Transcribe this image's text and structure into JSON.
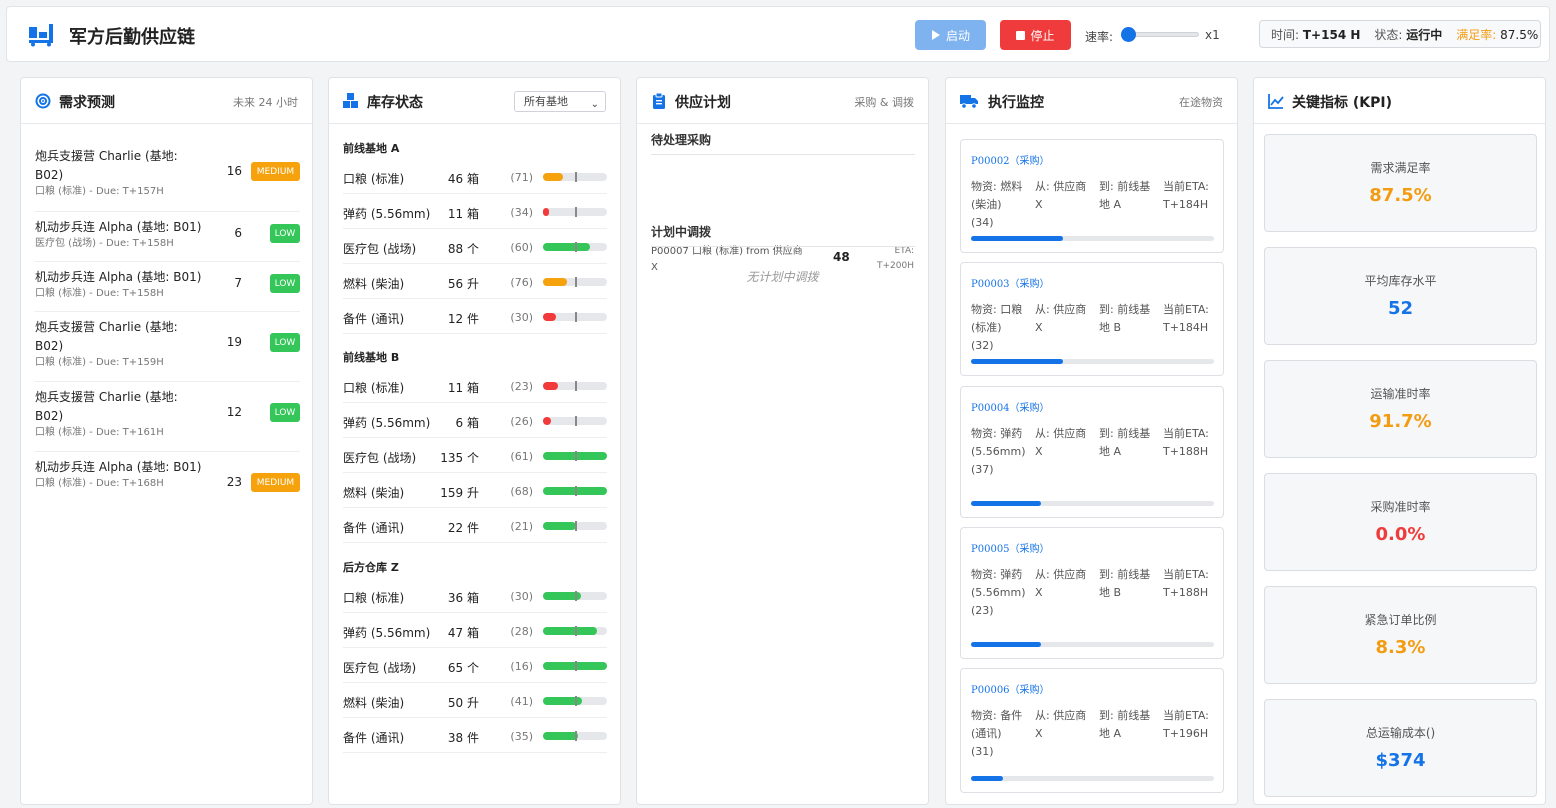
{
  "header": {
    "title": "军方后勤供应链",
    "start_label": "启动",
    "stop_label": "停止",
    "speed_label": "速率:",
    "speed_value": "x1",
    "speed_slider_value": 0,
    "time_label": "时间:",
    "time_value": "T+154 H",
    "state_label": "状态:",
    "state_value": "运行中",
    "rate_label": "满足率:",
    "rate_value": "87.5%"
  },
  "colors": {
    "accent_blue": "#1573e8",
    "start_button": "#7fb3ef",
    "stop_button": "#ef3b3b",
    "medium_badge": "#f5a20c",
    "low_badge": "#34c659",
    "bar_green": "#34c659",
    "bar_orange": "#f5a20c",
    "bar_red": "#f23a3a",
    "kpi_orange": "#f39c12",
    "kpi_blue": "#1573e8",
    "kpi_red": "#ef3b3b"
  },
  "demand": {
    "title": "需求预测",
    "subtitle": "未来 24 小时",
    "items": [
      {
        "name": "炮兵支援营 Charlie (基地: B02)",
        "meta": "口粮 (标准) - Due: T+157H",
        "qty": "16",
        "priority": "MEDIUM"
      },
      {
        "name": "机动步兵连 Alpha (基地: B01)",
        "meta": "医疗包 (战场) - Due: T+158H",
        "qty": "6",
        "priority": "LOW"
      },
      {
        "name": "机动步兵连 Alpha (基地: B01)",
        "meta": "口粮 (标准) - Due: T+158H",
        "qty": "7",
        "priority": "LOW"
      },
      {
        "name": "炮兵支援营 Charlie (基地: B02)",
        "meta": "口粮 (标准) - Due: T+159H",
        "qty": "19",
        "priority": "LOW"
      },
      {
        "name": "炮兵支援营 Charlie (基地: B02)",
        "meta": "口粮 (标准) - Due: T+161H",
        "qty": "12",
        "priority": "LOW"
      },
      {
        "name": "机动步兵连 Alpha (基地: B01)",
        "meta": "口粮 (标准) - Due: T+168H",
        "qty": "23",
        "priority": "MEDIUM"
      }
    ]
  },
  "inventory": {
    "title": "库存状态",
    "filter_value": "所有基地",
    "bases": [
      {
        "name": "前线基地 A",
        "items": [
          {
            "name": "口粮 (标准)",
            "qty": "46 箱",
            "threshold": "(71)",
            "level": 0.32,
            "mark": 0.5,
            "status": "orange"
          },
          {
            "name": "弹药 (5.56mm)",
            "qty": "11 箱",
            "threshold": "(34)",
            "level": 0.08,
            "mark": 0.5,
            "status": "red"
          },
          {
            "name": "医疗包 (战场)",
            "qty": "88 个",
            "threshold": "(60)",
            "level": 0.73,
            "mark": 0.5,
            "status": "green"
          },
          {
            "name": "燃料 (柴油)",
            "qty": "56 升",
            "threshold": "(76)",
            "level": 0.37,
            "mark": 0.5,
            "status": "orange"
          },
          {
            "name": "备件 (通讯)",
            "qty": "12 件",
            "threshold": "(30)",
            "level": 0.2,
            "mark": 0.5,
            "status": "red"
          }
        ]
      },
      {
        "name": "前线基地 B",
        "items": [
          {
            "name": "口粮 (标准)",
            "qty": "11 箱",
            "threshold": "(23)",
            "level": 0.24,
            "mark": 0.5,
            "status": "red"
          },
          {
            "name": "弹药 (5.56mm)",
            "qty": "6 箱",
            "threshold": "(26)",
            "level": 0.12,
            "mark": 0.5,
            "status": "red"
          },
          {
            "name": "医疗包 (战场)",
            "qty": "135 个",
            "threshold": "(61)",
            "level": 1.0,
            "mark": 0.5,
            "status": "green"
          },
          {
            "name": "燃料 (柴油)",
            "qty": "159 升",
            "threshold": "(68)",
            "level": 1.0,
            "mark": 0.5,
            "status": "green"
          },
          {
            "name": "备件 (通讯)",
            "qty": "22 件",
            "threshold": "(21)",
            "level": 0.52,
            "mark": 0.5,
            "status": "green"
          }
        ]
      },
      {
        "name": "后方仓库 Z",
        "items": [
          {
            "name": "口粮 (标准)",
            "qty": "36 箱",
            "threshold": "(30)",
            "level": 0.6,
            "mark": 0.5,
            "status": "green"
          },
          {
            "name": "弹药 (5.56mm)",
            "qty": "47 箱",
            "threshold": "(28)",
            "level": 0.84,
            "mark": 0.5,
            "status": "green"
          },
          {
            "name": "医疗包 (战场)",
            "qty": "65 个",
            "threshold": "(16)",
            "level": 1.0,
            "mark": 0.5,
            "status": "green"
          },
          {
            "name": "燃料 (柴油)",
            "qty": "50 升",
            "threshold": "(41)",
            "level": 0.61,
            "mark": 0.5,
            "status": "green"
          },
          {
            "name": "备件 (通讯)",
            "qty": "38 件",
            "threshold": "(35)",
            "level": 0.54,
            "mark": 0.5,
            "status": "green"
          }
        ]
      }
    ]
  },
  "plan": {
    "title": "供应计划",
    "subtitle": "采购 & 调拨",
    "pending_title": "待处理采购",
    "pending": [
      {
        "text": "P00007 口粮 (标准) from 供应商 X",
        "qty": "48",
        "eta_label": "ETA:",
        "eta": "T+200H"
      }
    ],
    "transfer_title": "计划中调拨",
    "transfer_empty": "无计划中调拨"
  },
  "monitor": {
    "title": "执行监控",
    "subtitle": "在途物资",
    "shipments": [
      {
        "id": "P00002（采购）",
        "material": "物资: 燃料 (柴油) (34)",
        "from": "从: 供应商 X",
        "to": "到: 前线基地 A",
        "eta": "当前ETA: T+184H",
        "progress": 0.38
      },
      {
        "id": "P00003（采购）",
        "material": "物资: 口粮 (标准) (32)",
        "from": "从: 供应商 X",
        "to": "到: 前线基地 B",
        "eta": "当前ETA: T+184H",
        "progress": 0.38
      },
      {
        "id": "P00004（采购）",
        "material": "物资: 弹药 (5.56mm) (37)",
        "from": "从: 供应商 X",
        "to": "到: 前线基地 A",
        "eta": "当前ETA: T+188H",
        "progress": 0.29
      },
      {
        "id": "P00005（采购）",
        "material": "物资: 弹药 (5.56mm) (23)",
        "from": "从: 供应商 X",
        "to": "到: 前线基地 B",
        "eta": "当前ETA: T+188H",
        "progress": 0.29
      },
      {
        "id": "P00006（采购）",
        "material": "物资: 备件 (通讯) (31)",
        "from": "从: 供应商 X",
        "to": "到: 前线基地 A",
        "eta": "当前ETA: T+196H",
        "progress": 0.13
      }
    ]
  },
  "kpi": {
    "title": "关键指标 (KPI)",
    "items": [
      {
        "label": "需求满足率",
        "value": "87.5%",
        "tone": "orange"
      },
      {
        "label": "平均库存水平",
        "value": "52",
        "tone": "blue"
      },
      {
        "label": "运输准时率",
        "value": "91.7%",
        "tone": "orange"
      },
      {
        "label": "采购准时率",
        "value": "0.0%",
        "tone": "red"
      },
      {
        "label": "紧急订单比例",
        "value": "8.3%",
        "tone": "orange"
      },
      {
        "label": "总运输成本()",
        "value": "$374",
        "tone": "blue"
      }
    ]
  }
}
